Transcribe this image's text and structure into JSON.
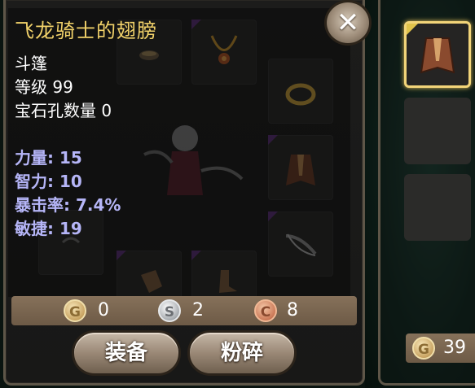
{
  "item": {
    "name": "飞龙骑士的翅膀",
    "type": "斗篷",
    "level_text": "等级 99",
    "socket_text": "宝石孔数量 0",
    "stats": [
      "力量: 15",
      "智力: 10",
      "暴击率: 7.4%",
      "敏捷: 19"
    ]
  },
  "close_button": {
    "label": "✕",
    "icon": "close-icon"
  },
  "currency": {
    "gold": {
      "symbol": "G",
      "value": "0"
    },
    "silver": {
      "symbol": "S",
      "value": "2"
    },
    "copper": {
      "symbol": "C",
      "value": "8"
    }
  },
  "actions": {
    "equip_label": "装备",
    "shatter_label": "粉碎"
  },
  "inventory": {
    "gold_total": "39",
    "gold_symbol": "G"
  },
  "colors": {
    "title": "#f2d26a",
    "stat": "#b5b5f7",
    "panel_border": "#5e5648",
    "selected_border": "#f2d479"
  }
}
